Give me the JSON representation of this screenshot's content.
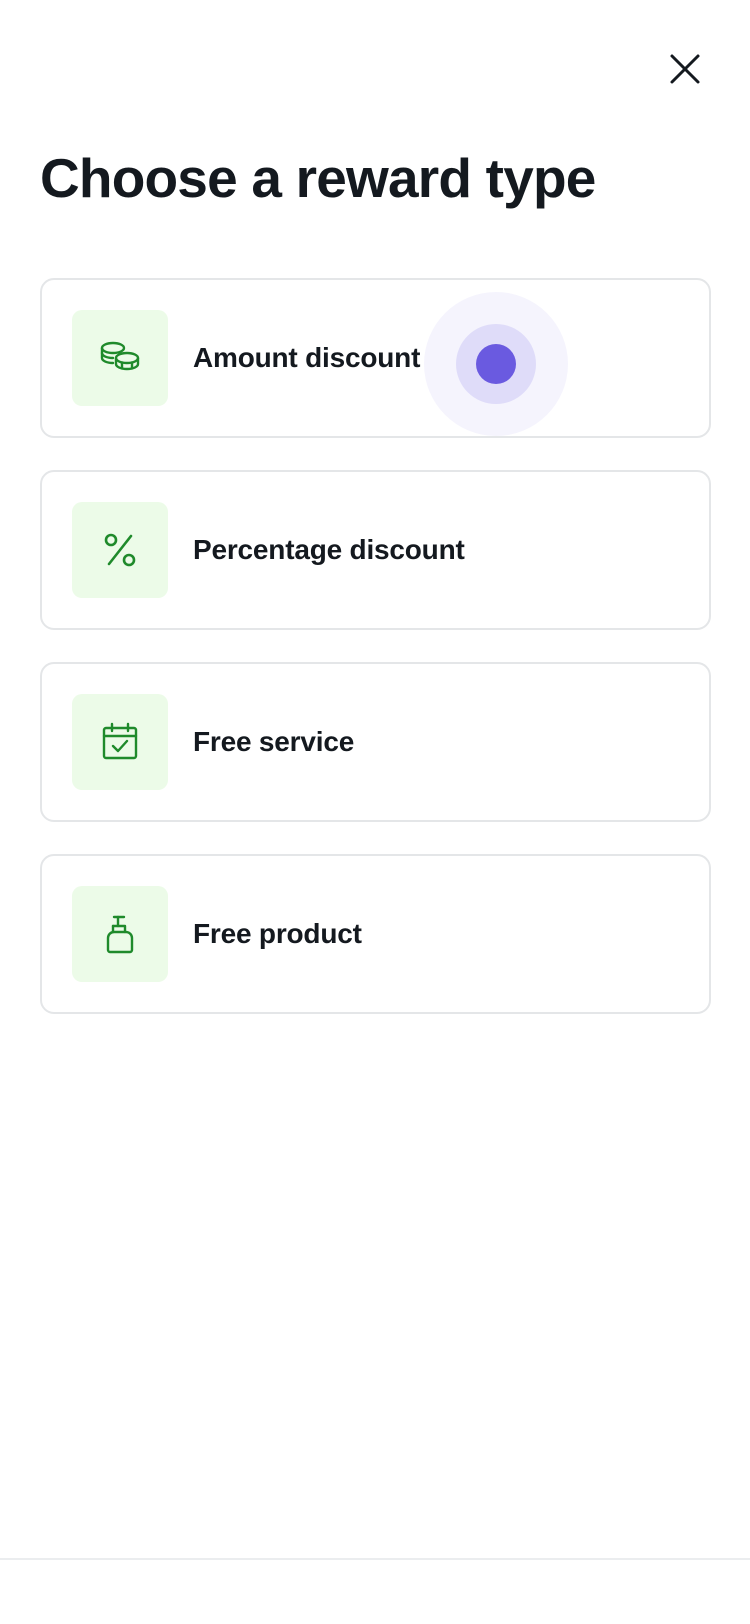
{
  "header": {
    "close_label": "Close",
    "title": "Choose a reward type"
  },
  "options": [
    {
      "label": "Amount discount",
      "icon": "coins-icon"
    },
    {
      "label": "Percentage discount",
      "icon": "percent-icon"
    },
    {
      "label": "Free service",
      "icon": "calendar-check-icon"
    },
    {
      "label": "Free product",
      "icon": "pump-bottle-icon"
    }
  ],
  "colors": {
    "accent_green": "#1f8a2b",
    "icon_bg": "#ecfbe8",
    "touch_indicator": "#6a5ae0",
    "card_border": "#e4e6e8"
  }
}
